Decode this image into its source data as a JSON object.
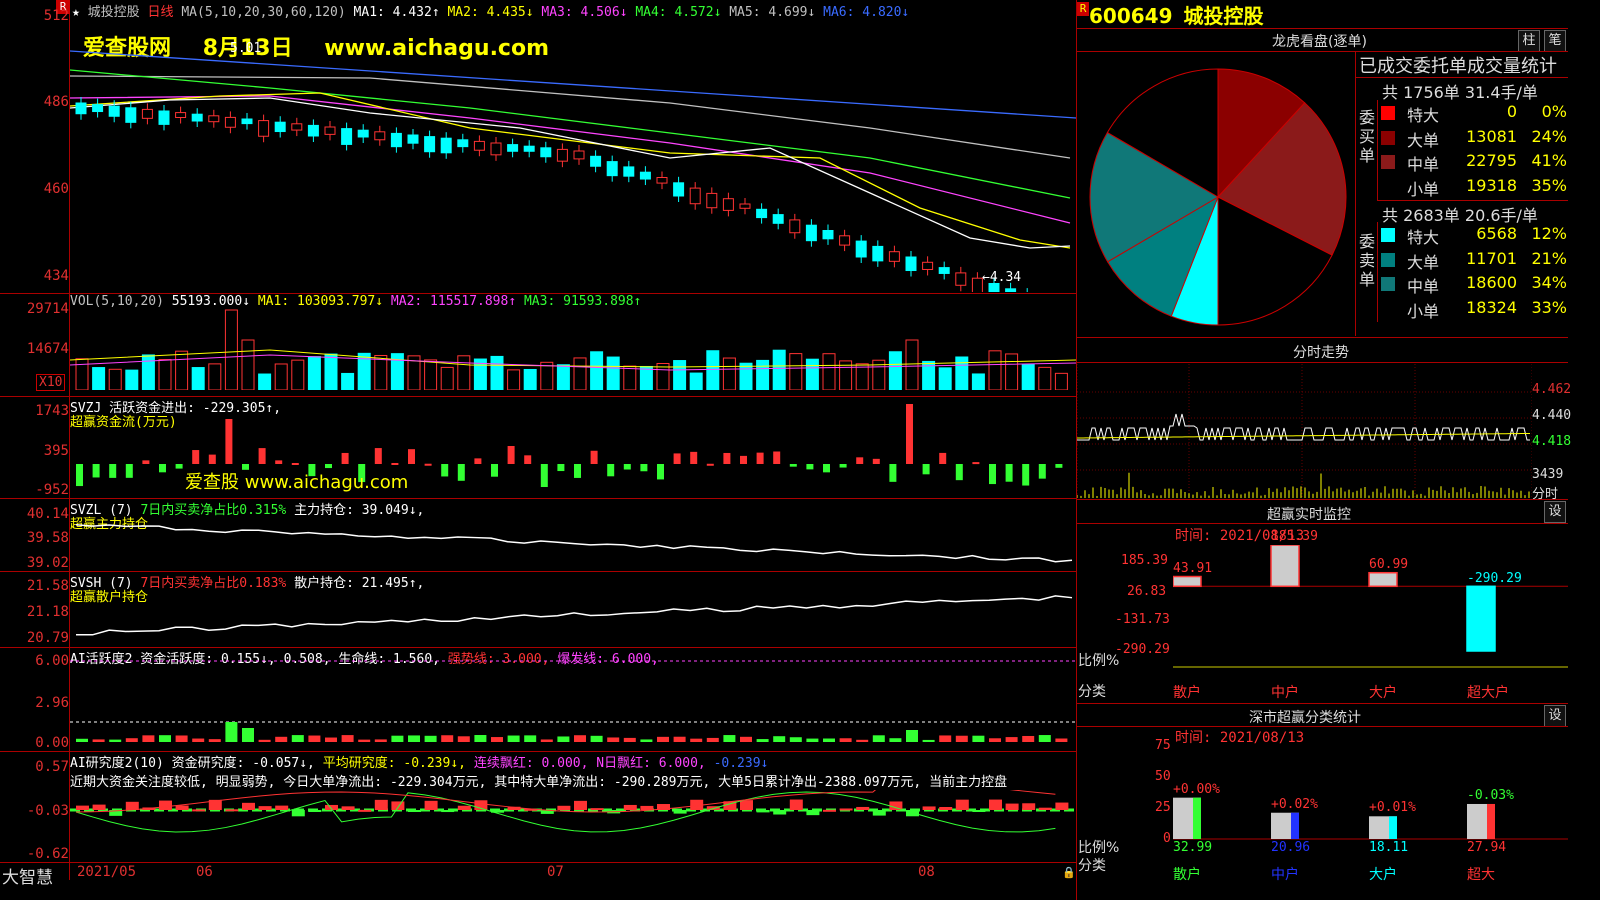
{
  "header": {
    "stock_name": "城投控股",
    "period": "日线",
    "ma_params": "MA(5,10,20,30,60,120)",
    "ma1": "MA1: 4.432↑",
    "ma2": "MA2: 4.435↓",
    "ma3": "MA3: 4.506↓",
    "ma4": "MA4: 4.572↓",
    "ma5": "MA5: 4.699↓",
    "ma6": "MA6: 4.820↓"
  },
  "watermark": {
    "site_name": "爱查股网",
    "date": "8月13日",
    "url": "www.aichagu.com",
    "small": "爱查股 www.aichagu.com"
  },
  "price_panel": {
    "axis": [
      "512",
      "486",
      "460",
      "434"
    ],
    "low_label": "←4.34",
    "high_label": "5.01"
  },
  "volume_panel": {
    "title": "VOL(5,10,20)",
    "value": "55193.000↓",
    "ma1": "MA1: 103093.797↓",
    "ma2": "MA2: 115517.898↑",
    "ma3": "MA3: 91593.898↑",
    "axis": [
      "29714",
      "14674"
    ],
    "unit": "X10"
  },
  "svzj_panel": {
    "line1": "SVZJ  活跃资金进出: -229.305↑,",
    "line2": "超赢资金流(万元)",
    "axis": [
      "1743",
      "395",
      "-952"
    ]
  },
  "svzl_panel": {
    "prefix": "SVZL (7)",
    "ratio": "7日内买卖净占比0.315%",
    "hold": "主力持仓: 39.049↓,",
    "line2": "超赢主力持仓",
    "axis": [
      "40.14",
      "39.58",
      "39.02"
    ]
  },
  "svsh_panel": {
    "prefix": "SVSH (7)",
    "ratio": "7日内买卖净占比0.183%",
    "hold": "散户持仓: 21.495↑,",
    "line2": "超赢散户持仓",
    "axis": [
      "21.58",
      "21.18",
      "20.79"
    ]
  },
  "ai_active_panel": {
    "title": "AI活跃度2 资金活跃度: 0.155↓, 0.508, 生命线: 1.560,",
    "strong": "强势线: 3.000,",
    "burst": "爆发线: 6.000,",
    "axis": [
      "6.00",
      "2.96",
      "0.00"
    ]
  },
  "ai_research_panel": {
    "title": "AI研究度2(10) 资金研究度: -0.057↓,",
    "avg": "平均研究度: -0.239↓,",
    "cont": "连续飘红: 0.000,",
    "nday": "N日飘红: 6.000,",
    "last": "-0.239↓",
    "comment": "近期大资金关注度较低, 明显弱势, 今日大单净流出: -229.304万元, 其中特大单净流出: -290.289万元, 大单5日累计净出-2388.097万元, 当前主力控盘",
    "axis": [
      "0.57",
      "-0.03",
      "-0.62"
    ]
  },
  "footer": {
    "brand": "大智慧",
    "dates": [
      "2021/05",
      "06",
      "07",
      "08"
    ]
  },
  "sidebar": {
    "code": "600649",
    "name": "城投控股",
    "r_badge": "R",
    "longhu_title": "龙虎看盘(逐单)",
    "btn_bar": "柱",
    "btn_pen": "笔",
    "stats_title": "已成交委托单成交量统计",
    "buy_summary": "共 1756单 31.4手/单",
    "sell_summary": "共 2683单 20.6手/单",
    "buy_label": "委买单",
    "sell_label": "委卖单",
    "buy_rows": [
      {
        "name": "特大",
        "vol": "0",
        "pct": "0%",
        "color": "#ff0000"
      },
      {
        "name": "大单",
        "vol": "13081",
        "pct": "24%",
        "color": "#8b0000"
      },
      {
        "name": "中单",
        "vol": "22795",
        "pct": "41%",
        "color": "#8b1a1a"
      },
      {
        "name": "小单",
        "vol": "19318",
        "pct": "35%",
        "color": "#000000"
      }
    ],
    "sell_rows": [
      {
        "name": "特大",
        "vol": "6568",
        "pct": "12%",
        "color": "#00ffff"
      },
      {
        "name": "大单",
        "vol": "11701",
        "pct": "21%",
        "color": "#008080"
      },
      {
        "name": "中单",
        "vol": "18600",
        "pct": "34%",
        "color": "#107878"
      },
      {
        "name": "小单",
        "vol": "18324",
        "pct": "33%",
        "color": "#000000"
      }
    ],
    "fenshi_title": "分时走势",
    "fenshi_axis": [
      "4.462",
      "4.440",
      "4.418",
      "3439",
      "分时"
    ],
    "monitor_title": "超赢实时监控",
    "monitor_btn": "设",
    "monitor_time": "时间: 2021/08/13",
    "monitor_axis": [
      "185.39",
      "26.83",
      "-131.73",
      "-290.29"
    ],
    "monitor_ratio": "比例%",
    "monitor_cat": "分类",
    "monitor_bars": [
      {
        "label": "散户",
        "value": "43.91"
      },
      {
        "label": "中户",
        "value": "185.39"
      },
      {
        "label": "大户",
        "value": "60.99"
      },
      {
        "label": "超大户",
        "value": "-290.29"
      }
    ],
    "shenshi_title": "深市超赢分类统计",
    "shenshi_btn": "设",
    "shenshi_time": "时间: 2021/08/13",
    "shenshi_axis": [
      "75",
      "50",
      "25",
      "0"
    ],
    "shenshi_bars": [
      {
        "label": "散户",
        "change": "+0.00%",
        "ratio": "32.99",
        "color": "#33ff33"
      },
      {
        "label": "中户",
        "change": "+0.02%",
        "ratio": "20.96",
        "color": "#2233ff"
      },
      {
        "label": "大户",
        "change": "+0.01%",
        "ratio": "18.11",
        "color": "#00ffff"
      },
      {
        "label": "超大",
        "change": "-0.03%",
        "ratio": "27.94",
        "color": "#ff3333"
      }
    ]
  }
}
